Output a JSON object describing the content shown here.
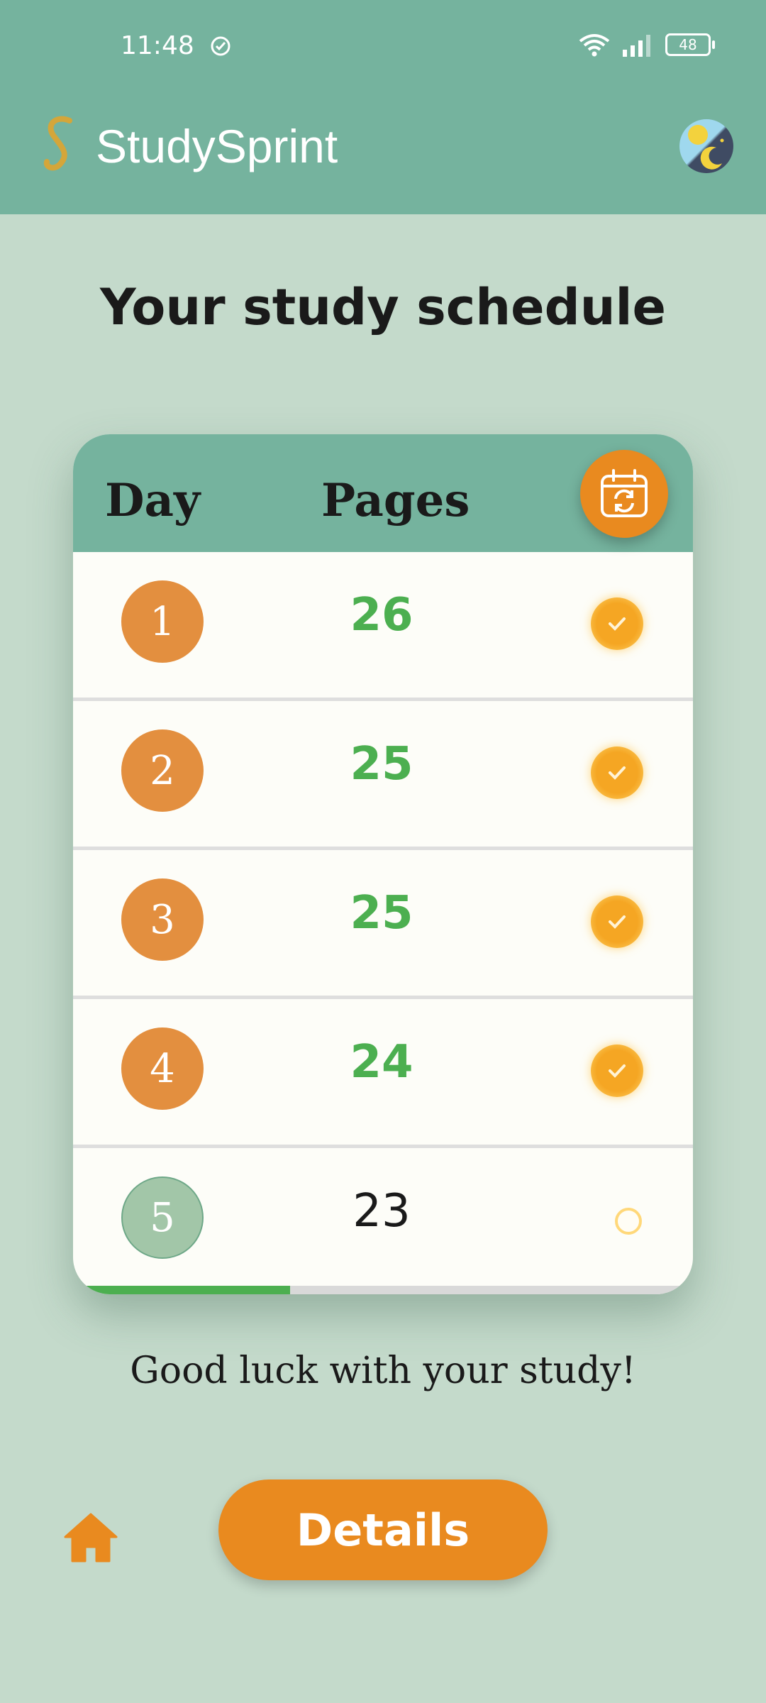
{
  "status_bar": {
    "time": "11:48",
    "battery": "48"
  },
  "app_bar": {
    "title": "StudySprint"
  },
  "page": {
    "title": "Your study schedule"
  },
  "table": {
    "headers": {
      "day": "Day",
      "pages": "Pages"
    },
    "rows": [
      {
        "day": "1",
        "pages": "26",
        "done": true
      },
      {
        "day": "2",
        "pages": "25",
        "done": true
      },
      {
        "day": "3",
        "pages": "25",
        "done": true
      },
      {
        "day": "4",
        "pages": "24",
        "done": true
      },
      {
        "day": "5",
        "pages": "23",
        "done": false
      }
    ],
    "progress_fraction": 0.35
  },
  "footer": {
    "message": "Good luck with your study!",
    "details_label": "Details"
  },
  "colors": {
    "primary": "#75b39e",
    "background": "#c4dacb",
    "accent": "#e98a1f",
    "done_text": "#4caf50"
  },
  "icons": {
    "logo": "s-logo-icon",
    "status_check": "check-circle-icon",
    "reschedule": "calendar-refresh-icon",
    "home": "home-icon",
    "done": "check-icon"
  }
}
